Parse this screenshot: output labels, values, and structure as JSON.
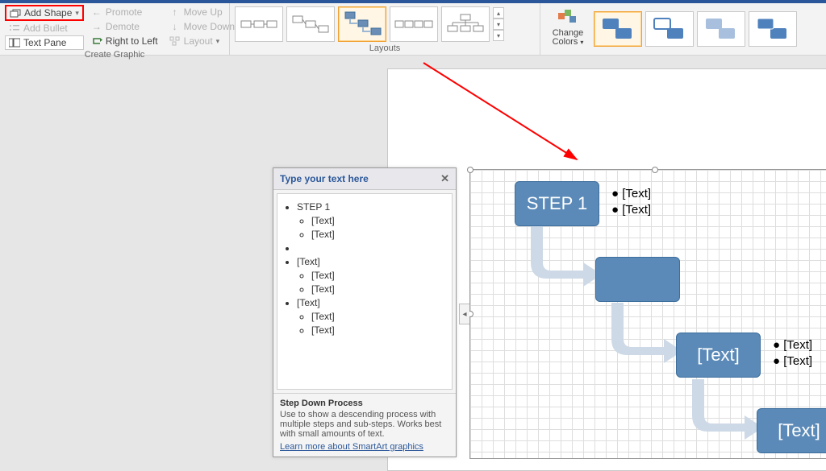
{
  "ribbon": {
    "add_shape": "Add Shape",
    "add_bullet": "Add Bullet",
    "text_pane": "Text Pane",
    "promote": "Promote",
    "demote": "Demote",
    "right_to_left": "Right to Left",
    "move_up": "Move Up",
    "move_down": "Move Down",
    "layout": "Layout",
    "group_create": "Create Graphic",
    "group_layouts": "Layouts",
    "change_colors": "Change Colors"
  },
  "textpane": {
    "title": "Type your text here",
    "items": [
      {
        "label": "STEP 1",
        "children": [
          "[Text]",
          "[Text]"
        ]
      },
      {
        "label": "",
        "children": []
      },
      {
        "label": "[Text]",
        "children": [
          "[Text]",
          "[Text]"
        ]
      },
      {
        "label": "[Text]",
        "children": [
          "[Text]",
          "[Text]"
        ]
      }
    ],
    "footer_title": "Step Down Process",
    "footer_desc": "Use to show a descending process with multiple steps and sub-steps. Works best with small amounts of text.",
    "footer_link": "Learn more about SmartArt graphics"
  },
  "smartart": {
    "nodes": {
      "step1": "STEP 1",
      "node2": "",
      "node3": "[Text]",
      "node4": "[Text]"
    },
    "bullets": {
      "step1": [
        "[Text]",
        "[Text]"
      ],
      "node3": [
        "[Text]",
        "[Text]"
      ]
    }
  }
}
